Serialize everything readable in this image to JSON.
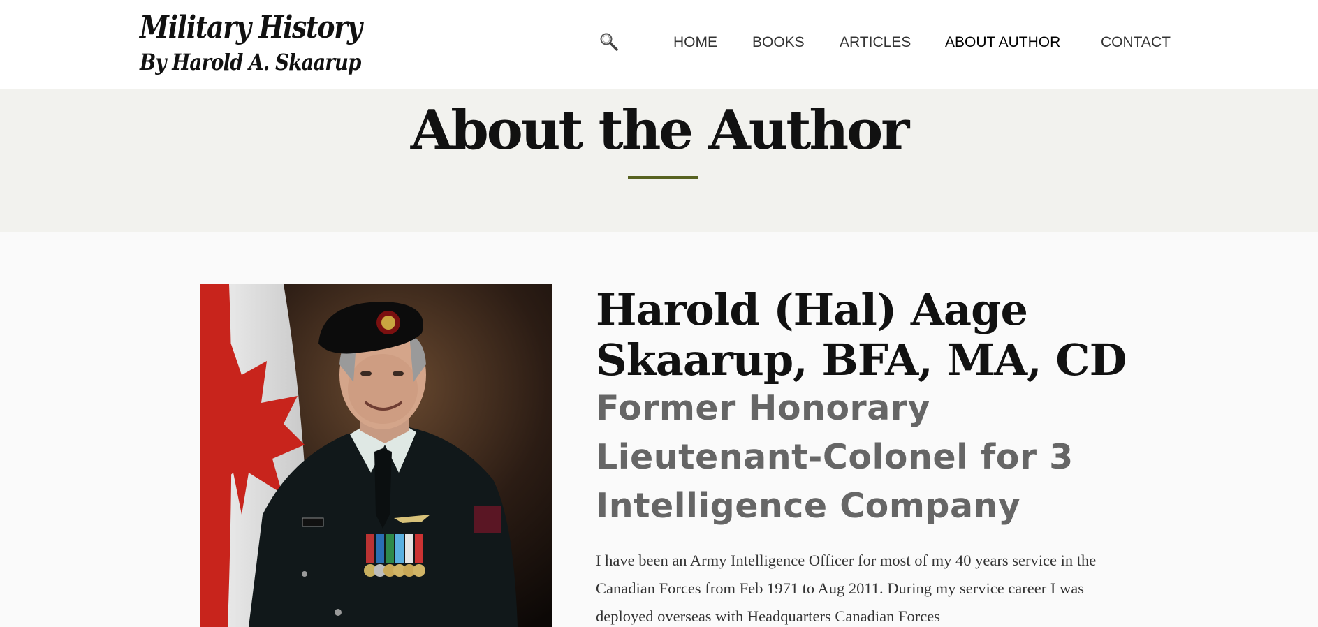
{
  "header": {
    "logo_line1": "Military History",
    "logo_line2": "By Harold A. Skaarup",
    "nav": [
      {
        "label": "HOME"
      },
      {
        "label": "BOOKS"
      },
      {
        "label": "ARTICLES"
      },
      {
        "label": "ABOUT AUTHOR"
      },
      {
        "label": "CONTACT"
      }
    ],
    "search_icon": "search-icon"
  },
  "banner": {
    "title": "About the Author",
    "accent_color": "#586321"
  },
  "author": {
    "name": "Harold (Hal) Aage Skaarup, BFA, MA, CD",
    "subtitle": "Former Honorary Lieutenant-Colonel for 3 Intelligence Company",
    "bio": "I have been an Army Intelligence Officer for most of my 40 years service in the Canadian Forces from Feb 1971 to Aug 2011. During my service career I was deployed overseas with Headquarters Canadian Forces"
  },
  "colors": {
    "header_bg": "#ffffff",
    "banner_bg": "#f2f2ee",
    "page_bg": "#fafafa",
    "subtitle_gray": "#666666"
  }
}
